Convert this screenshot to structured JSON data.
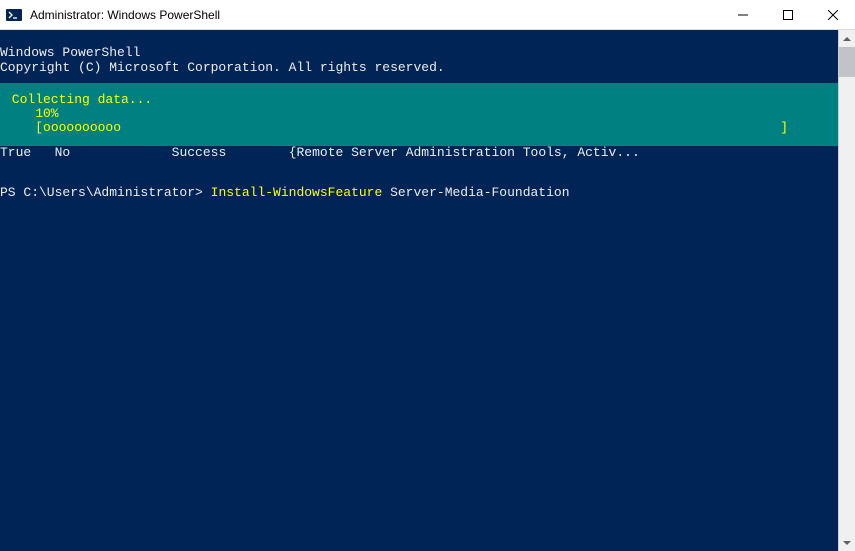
{
  "title_bar": {
    "title": "Administrator: Windows PowerShell"
  },
  "header": {
    "line1": "Windows PowerShell",
    "line2": "Copyright (C) Microsoft Corporation. All rights reserved."
  },
  "progress": {
    "status": " Collecting data...",
    "percent": "    10%",
    "bar_open": "    [",
    "bar_fill": "oooooooooo",
    "bar_close": "]"
  },
  "result": {
    "col1": "True",
    "col2": "No",
    "col3": "Success",
    "col4": "{Remote Server Administration Tools, Activ..."
  },
  "prompt": {
    "prefix": "PS C:\\Users\\Administrator> ",
    "command": "Install-WindowsFeature",
    "argument": " Server-Media-Foundation"
  }
}
